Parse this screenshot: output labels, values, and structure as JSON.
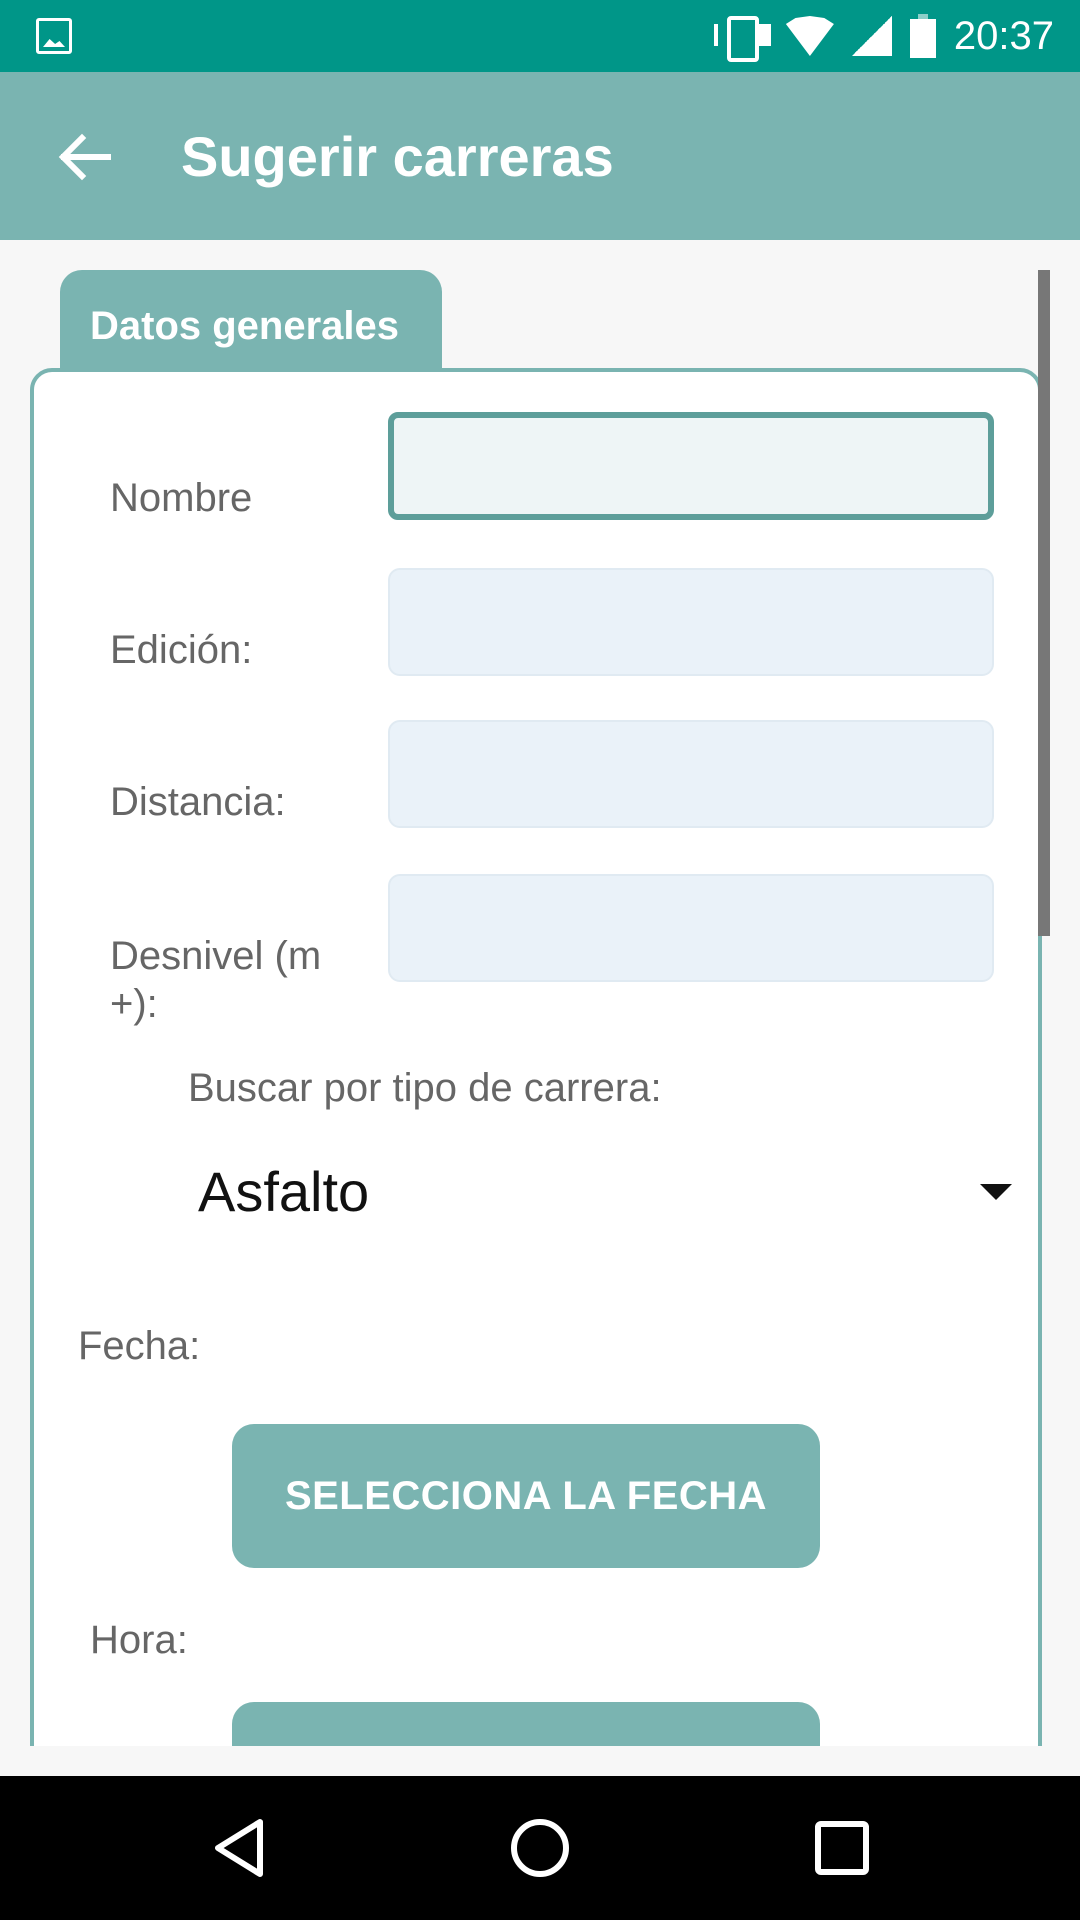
{
  "status_bar": {
    "time": "20:37",
    "icons": [
      "gallery-icon",
      "vibrate-icon",
      "wifi-icon",
      "signal-icon",
      "battery-icon"
    ]
  },
  "app_bar": {
    "title": "Sugerir carreras",
    "back_icon": "arrow-left-icon"
  },
  "tab": {
    "label": "Datos generales"
  },
  "form": {
    "fields": [
      {
        "label": "Nombre",
        "value": ""
      },
      {
        "label": "Edición:",
        "value": ""
      },
      {
        "label": "Distancia:",
        "value": ""
      },
      {
        "label": "Desnivel (m +):",
        "value": ""
      }
    ],
    "type_label": "Buscar por tipo de carrera:",
    "type_selected": "Asfalto",
    "date_label": "Fecha:",
    "date_button": "SELECCIONA LA FECHA",
    "time_label": "Hora:",
    "time_button": ""
  },
  "nav_bar": {
    "icons": [
      "back-triangle-icon",
      "home-circle-icon",
      "recents-square-icon"
    ]
  },
  "colors": {
    "status_bar": "#009688",
    "primary": "#7ab4b1",
    "field_bg": "#eaf2f9",
    "active_border": "#5d9e9a"
  }
}
